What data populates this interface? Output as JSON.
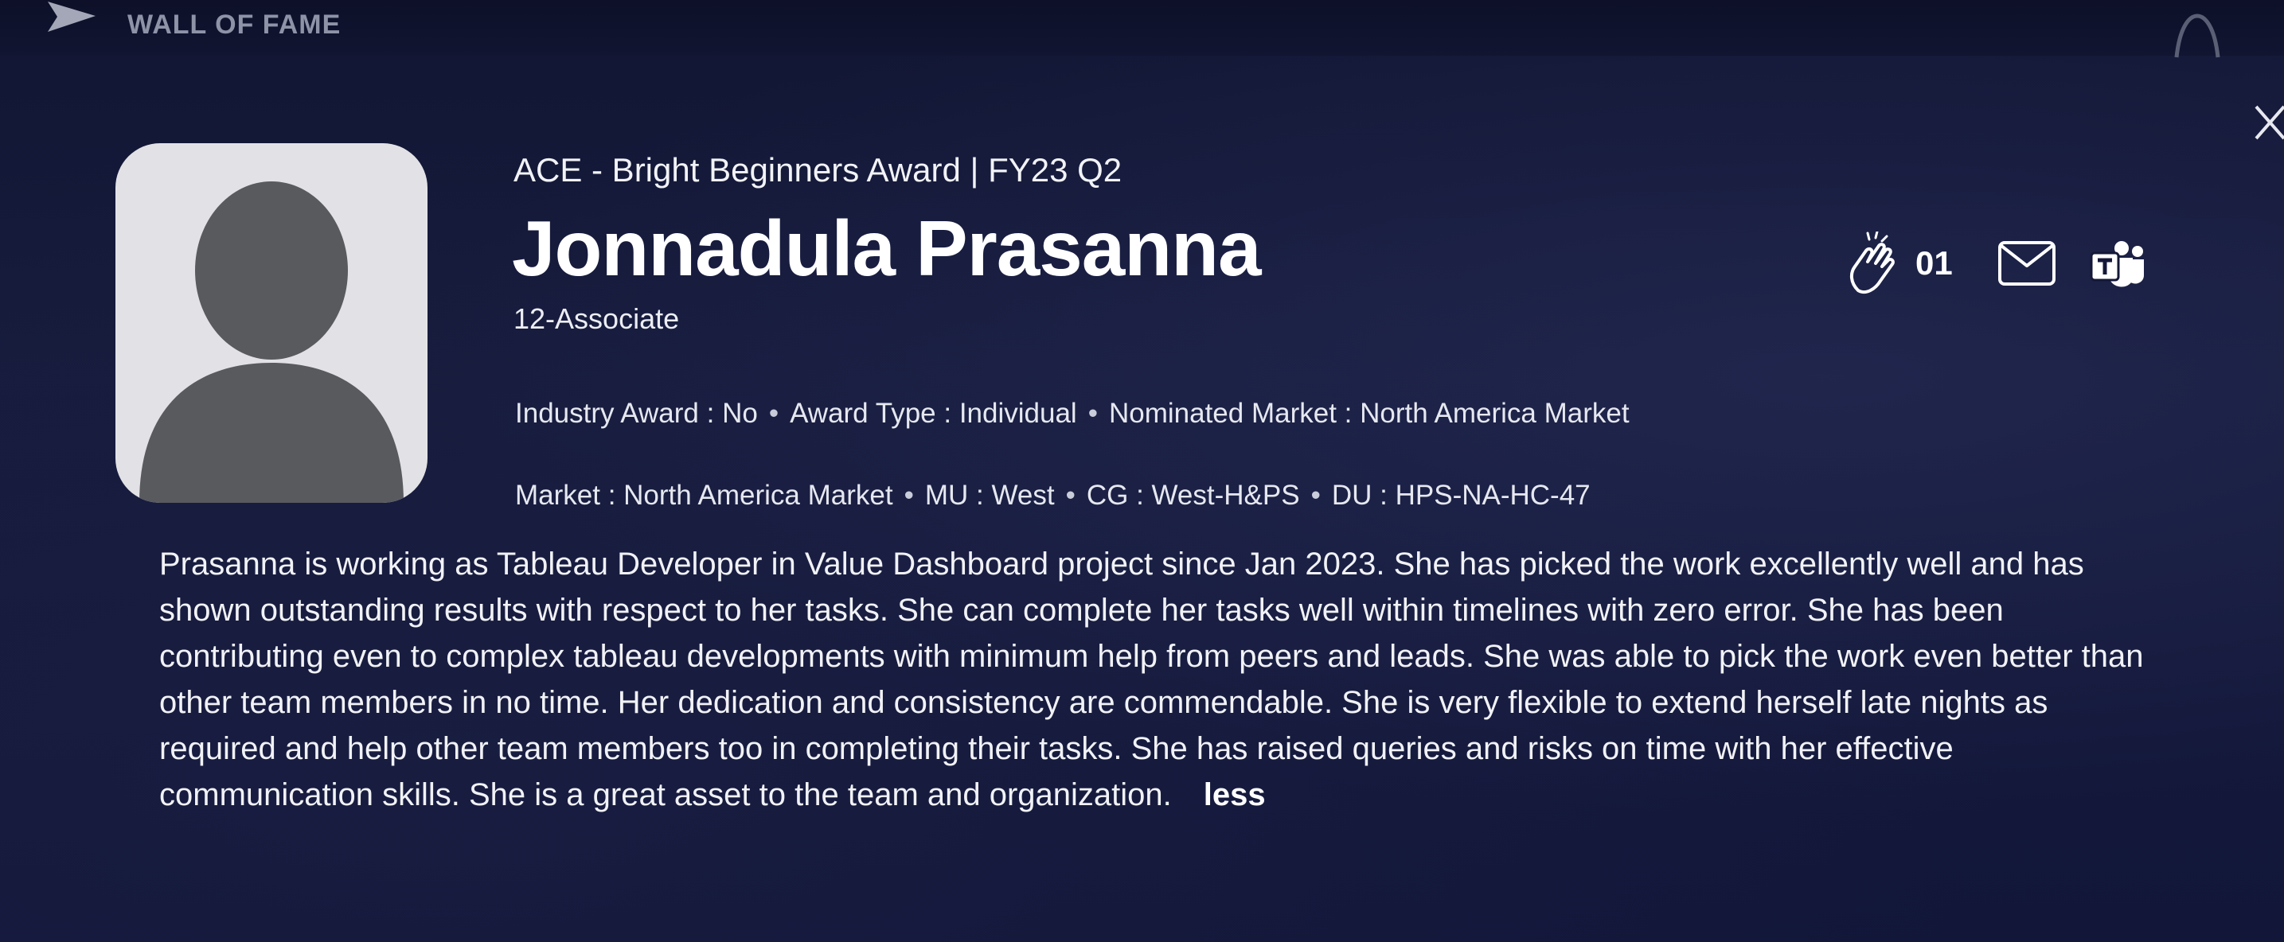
{
  "header": {
    "brand_title": "WALL OF FAME",
    "logo_icon": "brand-chevron-icon",
    "right_icon": "arch-icon"
  },
  "modal": {
    "close_icon": "close-icon",
    "award_title": "ACE - Bright Beginners Award | FY23 Q2",
    "name": "Jonnadula Prasanna",
    "designation": "12-Associate",
    "details_row1": [
      {
        "label": "Industry Award",
        "value": "No"
      },
      {
        "label": "Award Type",
        "value": "Individual"
      },
      {
        "label": "Nominated Market",
        "value": "North America Market"
      }
    ],
    "details_row2": [
      {
        "label": "Market",
        "value": "North America Market"
      },
      {
        "label": "MU",
        "value": "West"
      },
      {
        "label": "CG",
        "value": "West-H&PS"
      },
      {
        "label": "DU",
        "value": "HPS-NA-HC-47"
      }
    ],
    "actions": {
      "clap_icon": "clap-icon",
      "clap_count": "01",
      "mail_icon": "mail-icon",
      "teams_icon": "teams-icon"
    },
    "description": "Prasanna is working as Tableau Developer in Value Dashboard project since Jan 2023. She has picked the work excellently well and has shown outstanding results with respect to her tasks. She can complete her tasks well within timelines with zero error. She has been contributing even to complex tableau developments with minimum help from peers and leads. She was able to pick the work even better than other team members in no time. Her dedication and consistency are commendable. She is very flexible to extend herself late nights as required and help other team members too in completing their tasks. She has raised queries and risks on time with her effective communication skills. She is a great asset to the team and organization.",
    "less_label": "less"
  },
  "colors": {
    "background": "#141838",
    "text": "#f2f3f7",
    "muted": "#8e93a8",
    "avatar_bg": "#e2e2e6",
    "avatar_fg": "#595a5e"
  }
}
